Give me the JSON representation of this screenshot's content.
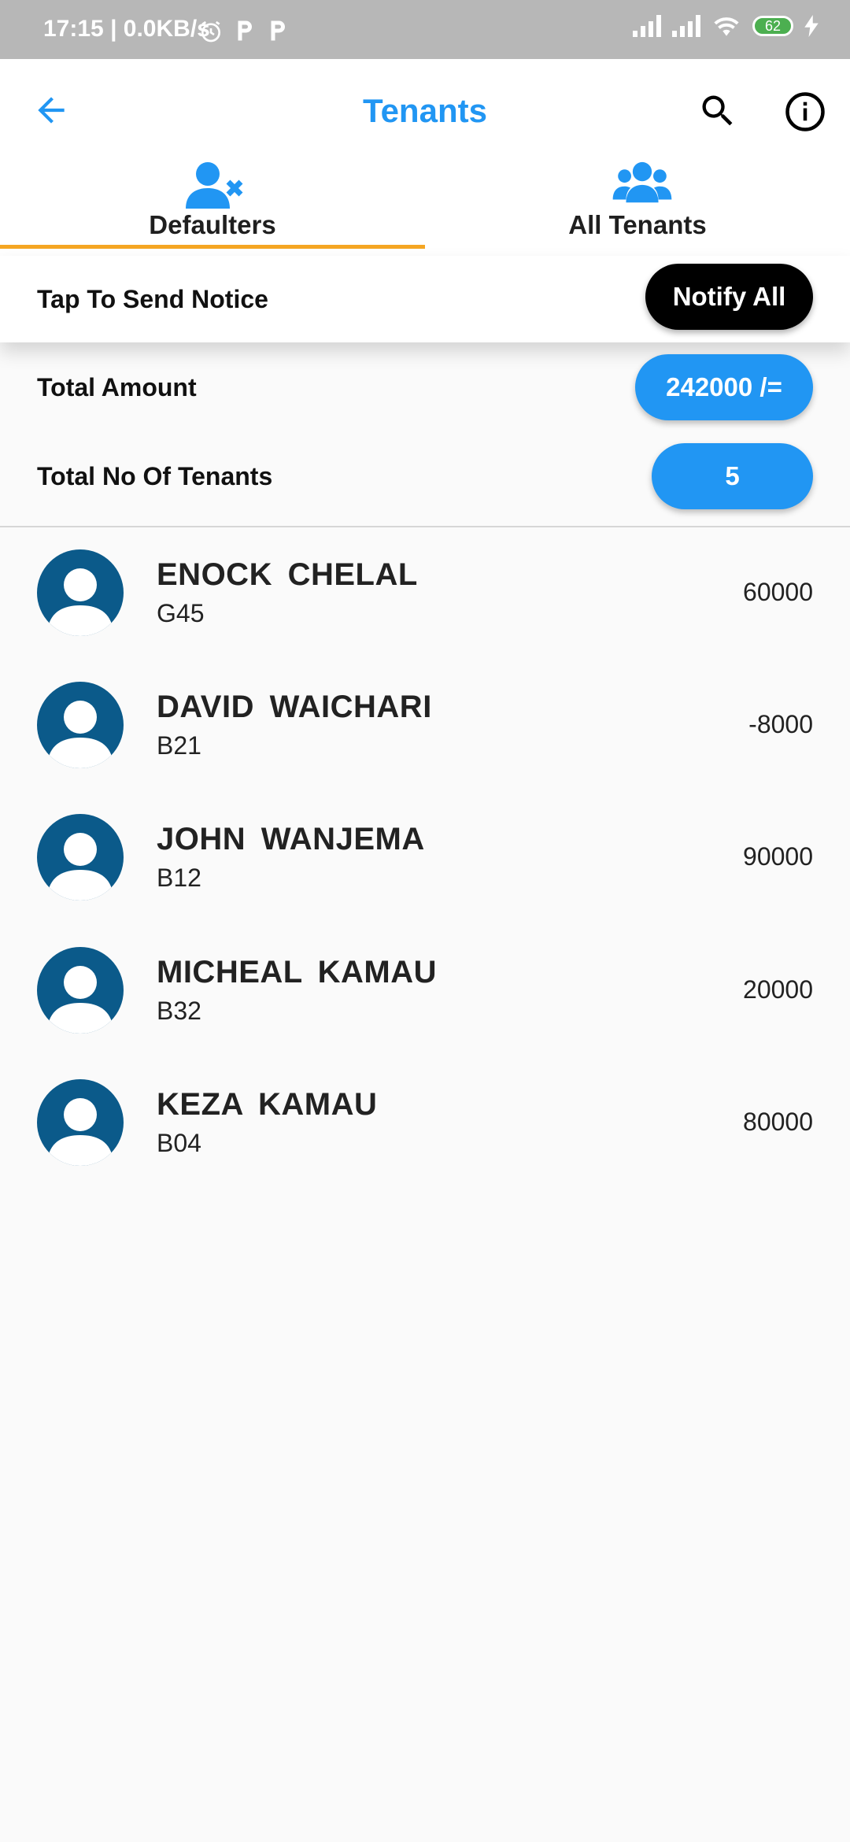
{
  "status_bar": {
    "time": "17:15 | 0.0KB/s",
    "battery": "62",
    "icons": [
      "alarm-icon",
      "p-icon",
      "p-icon",
      "signal-icon",
      "signal-icon",
      "wifi-icon",
      "battery-icon",
      "charging-icon"
    ]
  },
  "app_bar": {
    "title": "Tenants",
    "back_icon": "arrow-back-icon",
    "search_icon": "search-icon",
    "info_icon": "info-icon",
    "accent_color": "#2196f3"
  },
  "tabs": [
    {
      "label": "Defaulters",
      "icon": "user-remove-icon",
      "selected": true
    },
    {
      "label": "All Tenants",
      "icon": "users-group-icon",
      "selected": false
    }
  ],
  "indicator_color": "#f5a623",
  "notice": {
    "label": "Tap To Send Notice",
    "button": "Notify All"
  },
  "summary": {
    "total_amount_label": "Total Amount",
    "total_amount_value": "242000 /=",
    "total_tenants_label": "Total No Of Tenants",
    "total_tenants_value": "5"
  },
  "tenants": [
    {
      "name": "ENOCK  CHELAL",
      "unit": "G45",
      "amount": "60000"
    },
    {
      "name": "DAVID  WAICHARI",
      "unit": "B21",
      "amount": "-8000"
    },
    {
      "name": "JOHN  WANJEMA",
      "unit": "B12",
      "amount": "90000"
    },
    {
      "name": "MICHEAL  KAMAU",
      "unit": "B32",
      "amount": "20000"
    },
    {
      "name": "KEZA  KAMAU",
      "unit": "B04",
      "amount": "80000"
    }
  ]
}
